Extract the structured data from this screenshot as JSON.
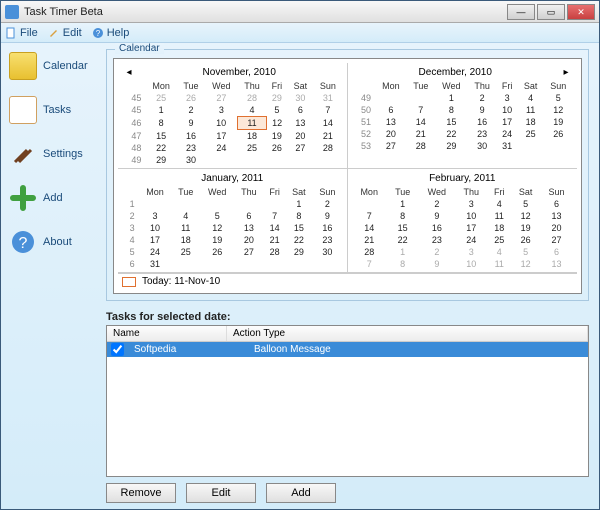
{
  "window": {
    "title": "Task Timer Beta"
  },
  "menubar": {
    "file": "File",
    "edit": "Edit",
    "help": "Help"
  },
  "sidebar": {
    "items": [
      {
        "label": "Calendar"
      },
      {
        "label": "Tasks"
      },
      {
        "label": "Settings"
      },
      {
        "label": "Add"
      },
      {
        "label": "About"
      }
    ]
  },
  "calendar": {
    "group_title": "Calendar",
    "today_label": "Today: 11-Nov-10",
    "day_headers": [
      "Mon",
      "Tue",
      "Wed",
      "Thu",
      "Fri",
      "Sat",
      "Sun"
    ],
    "months": [
      {
        "title": "November, 2010",
        "show_weeks": true,
        "rows": [
          {
            "wk": "45",
            "days": [
              {
                "n": "25",
                "dim": true
              },
              {
                "n": "26",
                "dim": true
              },
              {
                "n": "27",
                "dim": true
              },
              {
                "n": "28",
                "dim": true
              },
              {
                "n": "29",
                "dim": true
              },
              {
                "n": "30",
                "dim": true
              },
              {
                "n": "31",
                "dim": true
              }
            ]
          },
          {
            "wk": "45",
            "days": [
              {
                "n": "1"
              },
              {
                "n": "2"
              },
              {
                "n": "3"
              },
              {
                "n": "4"
              },
              {
                "n": "5"
              },
              {
                "n": "6"
              },
              {
                "n": "7"
              }
            ]
          },
          {
            "wk": "46",
            "days": [
              {
                "n": "8"
              },
              {
                "n": "9"
              },
              {
                "n": "10"
              },
              {
                "n": "11",
                "today": true
              },
              {
                "n": "12"
              },
              {
                "n": "13"
              },
              {
                "n": "14"
              }
            ]
          },
          {
            "wk": "47",
            "days": [
              {
                "n": "15"
              },
              {
                "n": "16"
              },
              {
                "n": "17"
              },
              {
                "n": "18"
              },
              {
                "n": "19"
              },
              {
                "n": "20"
              },
              {
                "n": "21"
              }
            ]
          },
          {
            "wk": "48",
            "days": [
              {
                "n": "22"
              },
              {
                "n": "23"
              },
              {
                "n": "24"
              },
              {
                "n": "25"
              },
              {
                "n": "26"
              },
              {
                "n": "27"
              },
              {
                "n": "28"
              }
            ]
          },
          {
            "wk": "49",
            "days": [
              {
                "n": "29"
              },
              {
                "n": "30"
              },
              {
                "n": ""
              },
              {
                "n": ""
              },
              {
                "n": ""
              },
              {
                "n": ""
              },
              {
                "n": ""
              }
            ]
          }
        ]
      },
      {
        "title": "December, 2010",
        "show_weeks": true,
        "rows": [
          {
            "wk": "49",
            "days": [
              {
                "n": ""
              },
              {
                "n": ""
              },
              {
                "n": "1"
              },
              {
                "n": "2"
              },
              {
                "n": "3"
              },
              {
                "n": "4"
              },
              {
                "n": "5"
              }
            ]
          },
          {
            "wk": "50",
            "days": [
              {
                "n": "6"
              },
              {
                "n": "7"
              },
              {
                "n": "8"
              },
              {
                "n": "9"
              },
              {
                "n": "10"
              },
              {
                "n": "11"
              },
              {
                "n": "12"
              }
            ]
          },
          {
            "wk": "51",
            "days": [
              {
                "n": "13"
              },
              {
                "n": "14"
              },
              {
                "n": "15"
              },
              {
                "n": "16"
              },
              {
                "n": "17"
              },
              {
                "n": "18"
              },
              {
                "n": "19"
              }
            ]
          },
          {
            "wk": "52",
            "days": [
              {
                "n": "20"
              },
              {
                "n": "21"
              },
              {
                "n": "22"
              },
              {
                "n": "23"
              },
              {
                "n": "24"
              },
              {
                "n": "25"
              },
              {
                "n": "26"
              }
            ]
          },
          {
            "wk": "53",
            "days": [
              {
                "n": "27"
              },
              {
                "n": "28"
              },
              {
                "n": "29"
              },
              {
                "n": "30"
              },
              {
                "n": "31"
              },
              {
                "n": ""
              },
              {
                "n": ""
              }
            ]
          }
        ]
      },
      {
        "title": "January, 2011",
        "show_weeks": true,
        "rows": [
          {
            "wk": "1",
            "days": [
              {
                "n": ""
              },
              {
                "n": ""
              },
              {
                "n": ""
              },
              {
                "n": ""
              },
              {
                "n": ""
              },
              {
                "n": "1"
              },
              {
                "n": "2"
              }
            ]
          },
          {
            "wk": "2",
            "days": [
              {
                "n": "3"
              },
              {
                "n": "4"
              },
              {
                "n": "5"
              },
              {
                "n": "6"
              },
              {
                "n": "7"
              },
              {
                "n": "8"
              },
              {
                "n": "9"
              }
            ]
          },
          {
            "wk": "3",
            "days": [
              {
                "n": "10"
              },
              {
                "n": "11"
              },
              {
                "n": "12"
              },
              {
                "n": "13"
              },
              {
                "n": "14"
              },
              {
                "n": "15"
              },
              {
                "n": "16"
              }
            ]
          },
          {
            "wk": "4",
            "days": [
              {
                "n": "17"
              },
              {
                "n": "18"
              },
              {
                "n": "19"
              },
              {
                "n": "20"
              },
              {
                "n": "21"
              },
              {
                "n": "22"
              },
              {
                "n": "23"
              }
            ]
          },
          {
            "wk": "5",
            "days": [
              {
                "n": "24"
              },
              {
                "n": "25"
              },
              {
                "n": "26"
              },
              {
                "n": "27"
              },
              {
                "n": "28"
              },
              {
                "n": "29"
              },
              {
                "n": "30"
              }
            ]
          },
          {
            "wk": "6",
            "days": [
              {
                "n": "31"
              },
              {
                "n": ""
              },
              {
                "n": ""
              },
              {
                "n": ""
              },
              {
                "n": ""
              },
              {
                "n": ""
              },
              {
                "n": ""
              }
            ]
          }
        ]
      },
      {
        "title": "February, 2011",
        "show_weeks": false,
        "rows": [
          {
            "wk": "",
            "days": [
              {
                "n": ""
              },
              {
                "n": "1"
              },
              {
                "n": "2"
              },
              {
                "n": "3"
              },
              {
                "n": "4"
              },
              {
                "n": "5"
              },
              {
                "n": "6"
              }
            ]
          },
          {
            "wk": "",
            "days": [
              {
                "n": "7"
              },
              {
                "n": "8"
              },
              {
                "n": "9"
              },
              {
                "n": "10"
              },
              {
                "n": "11"
              },
              {
                "n": "12"
              },
              {
                "n": "13"
              }
            ]
          },
          {
            "wk": "",
            "days": [
              {
                "n": "14"
              },
              {
                "n": "15"
              },
              {
                "n": "16"
              },
              {
                "n": "17"
              },
              {
                "n": "18"
              },
              {
                "n": "19"
              },
              {
                "n": "20"
              }
            ]
          },
          {
            "wk": "",
            "days": [
              {
                "n": "21"
              },
              {
                "n": "22"
              },
              {
                "n": "23"
              },
              {
                "n": "24"
              },
              {
                "n": "25"
              },
              {
                "n": "26"
              },
              {
                "n": "27"
              }
            ]
          },
          {
            "wk": "",
            "days": [
              {
                "n": "28"
              },
              {
                "n": "1",
                "dim": true
              },
              {
                "n": "2",
                "dim": true
              },
              {
                "n": "3",
                "dim": true
              },
              {
                "n": "4",
                "dim": true
              },
              {
                "n": "5",
                "dim": true
              },
              {
                "n": "6",
                "dim": true
              }
            ]
          },
          {
            "wk": "",
            "days": [
              {
                "n": "7",
                "dim": true
              },
              {
                "n": "8",
                "dim": true
              },
              {
                "n": "9",
                "dim": true
              },
              {
                "n": "10",
                "dim": true
              },
              {
                "n": "11",
                "dim": true
              },
              {
                "n": "12",
                "dim": true
              },
              {
                "n": "13",
                "dim": true
              }
            ]
          }
        ]
      }
    ]
  },
  "tasks": {
    "label": "Tasks for selected date:",
    "columns": {
      "name": "Name",
      "action": "Action Type"
    },
    "rows": [
      {
        "checked": true,
        "name": "Softpedia",
        "action": "Balloon Message"
      }
    ]
  },
  "buttons": {
    "remove": "Remove",
    "edit": "Edit",
    "add": "Add"
  }
}
